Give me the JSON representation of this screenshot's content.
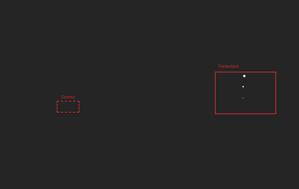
{
  "colors": {
    "background": "#252525",
    "accent_red": "#cc2b2b",
    "dot_bright": "#f2f2f2",
    "dot_mid": "#d8d8d8",
    "dot_dim": "#7a7a7a"
  },
  "objects": {
    "dummy": {
      "label": "Dummy"
    },
    "tracker": {
      "label": "Trackerboot"
    }
  }
}
